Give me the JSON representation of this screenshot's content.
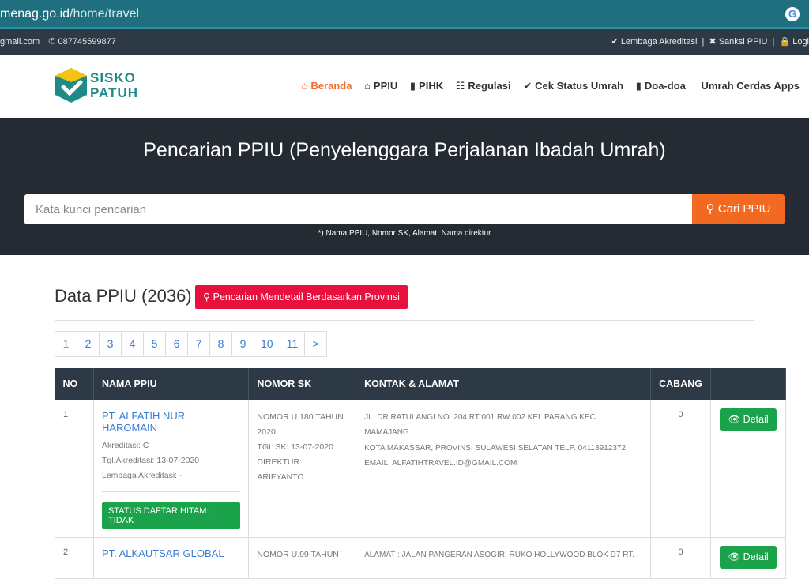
{
  "browser": {
    "url_host": "menag.go.id",
    "url_path": "/home/travel"
  },
  "topbar": {
    "email": "gmail.com",
    "phone": "087745599877",
    "links": [
      "Lembaga Akreditasi",
      "Sanksi PPIU",
      "Logi"
    ]
  },
  "logo": {
    "line1": "SISKO",
    "line2": "PATUH"
  },
  "nav": [
    {
      "label": "Beranda",
      "icon": "home-icon",
      "active": true
    },
    {
      "label": "PPIU",
      "icon": "home-icon"
    },
    {
      "label": "PIHK",
      "icon": "book-icon"
    },
    {
      "label": "Regulasi",
      "icon": "sitemap-icon"
    },
    {
      "label": "Cek Status Umrah",
      "icon": "check-icon"
    },
    {
      "label": "Doa-doa",
      "icon": "book-icon"
    },
    {
      "label": "Umrah Cerdas Apps",
      "icon": ""
    }
  ],
  "hero": {
    "title": "Pencarian PPIU (Penyelenggara Perjalanan Ibadah Umrah)",
    "search_placeholder": "Kata kunci pencarian",
    "search_button": "Cari PPIU",
    "hint": "*) Nama PPIU, Nomor SK, Alamat, Nama direktur"
  },
  "data_section": {
    "title": "Data PPIU (2036)",
    "province_button": "Pencarian Mendetail Berdasarkan Provinsi"
  },
  "pagination": [
    "1",
    "2",
    "3",
    "4",
    "5",
    "6",
    "7",
    "8",
    "9",
    "10",
    "11",
    ">"
  ],
  "table": {
    "headers": [
      "NO",
      "NAMA PPIU",
      "NOMOR SK",
      "KONTAK & ALAMAT",
      "CABANG",
      ""
    ],
    "rows": [
      {
        "no": "1",
        "name": "PT. ALFATIH NUR HAROMAIN",
        "akreditasi": "Akreditasi: C",
        "tgl": "Tgl.Akreditasi: 13-07-2020",
        "lembaga": "Lembaga Akreditasi: -",
        "status": "STATUS DAFTAR HITAM: TIDAK",
        "sk1": "NOMOR U.180 TAHUN",
        "sk2": "2020",
        "sk3": "TGL SK: 13-07-2020",
        "sk4": "DIREKTUR: ARIFYANTO",
        "addr1": "JL. DR RATULANGI NO. 204 RT 001 RW 002 KEL PARANG KEC MAMAJANG",
        "addr2": "KOTA MAKASSAR, PROVINSI SULAWESI SELATAN TELP. 04118912372",
        "addr3": "EMAIL: ALFATIHTRAVEL.ID@GMAIL.COM",
        "cabang": "0",
        "detail": "Detail"
      },
      {
        "no": "2",
        "name": "PT. ALKAUTSAR GLOBAL",
        "sk1": "NOMOR U.99 TAHUN",
        "addr1": "ALAMAT : JALAN PANGERAN ASOGIRI RUKO HOLLYWOOD BLOK D7 RT.",
        "cabang": "0",
        "detail": "Detail"
      }
    ]
  }
}
